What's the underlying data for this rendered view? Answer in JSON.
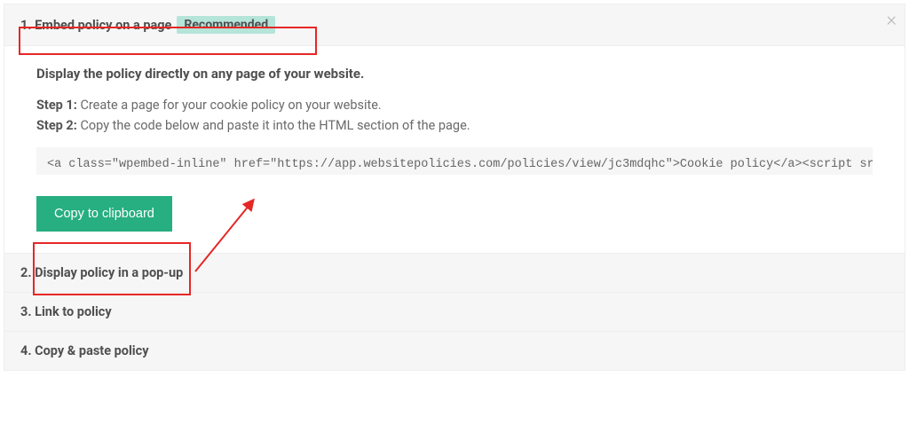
{
  "close_label": "×",
  "accordion": {
    "item1": {
      "title": "1. Embed policy on a page",
      "badge": "Recommended"
    },
    "item2": {
      "title": "2. Display policy in a pop-up"
    },
    "item3": {
      "title": "3. Link to policy"
    },
    "item4": {
      "title": "4. Copy & paste policy"
    }
  },
  "content": {
    "description": "Display the policy directly on any page of your website.",
    "step1_label": "Step 1:",
    "step1_text": " Create a page for your cookie policy on your website.",
    "step2_label": "Step 2:",
    "step2_text": " Copy the code below and paste it into the HTML section of the page.",
    "code": "<a class=\"wpembed-inline\" href=\"https://app.websitepolicies.com/policies/view/jc3mdqhc\">Cookie policy</a><script src=\"https",
    "copy_button": "Copy to clipboard"
  }
}
